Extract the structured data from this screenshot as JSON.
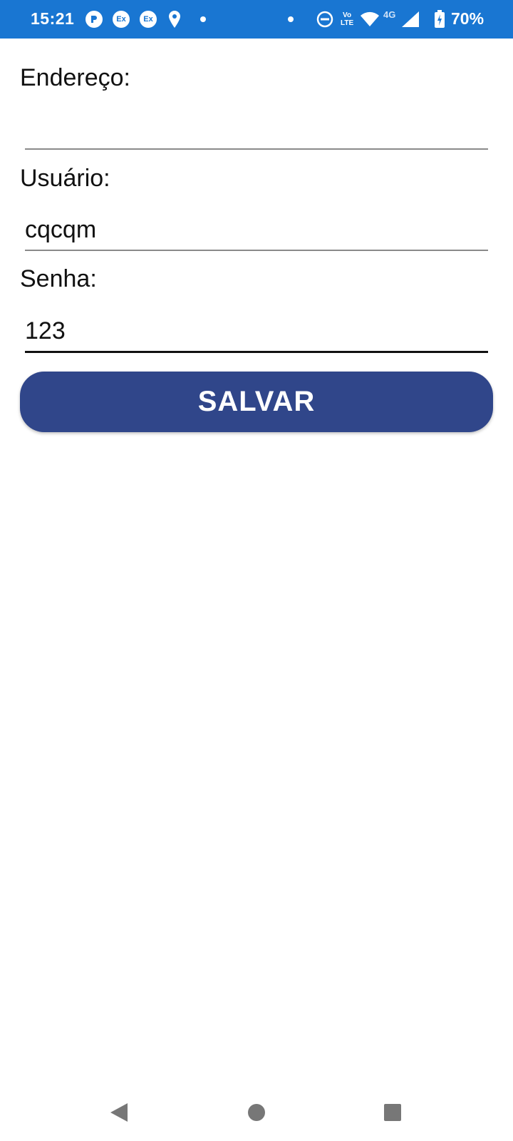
{
  "status_bar": {
    "time": "15:21",
    "icons": [
      "pay-icon",
      "exchange-icon",
      "exchange-icon",
      "location-icon",
      "dot-icon",
      "dot-icon",
      "do-not-disturb-icon",
      "volte-icon",
      "wifi-icon",
      "signal-4g-icon",
      "battery-charging-icon"
    ],
    "ex_badge": "Ex",
    "volte_top": "Vo",
    "volte_bottom": "LTE",
    "network": "4G",
    "battery": "70%"
  },
  "form": {
    "address_label": "Endereço:",
    "address_value": "",
    "user_label": "Usuário:",
    "user_value": "cqcqm",
    "password_label": "Senha:",
    "password_value": "123",
    "save_label": "SALVAR"
  },
  "nav_bar": {
    "buttons": [
      "back-icon",
      "home-icon",
      "recents-icon"
    ]
  },
  "colors": {
    "status_bar": "#1976d2",
    "button": "#30468a"
  }
}
